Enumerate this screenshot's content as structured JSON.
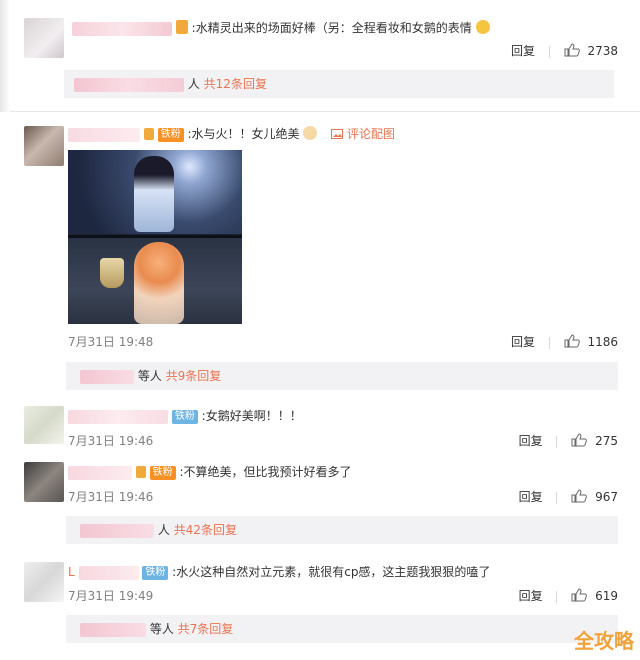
{
  "top_comment": {
    "text": ":水精灵出来的场面好棒（另：全程看妆和女鹅的表情",
    "actions": {
      "reply": "回复",
      "likes": "2738"
    },
    "replies": {
      "suffix": "人",
      "more": "共12条回复"
    }
  },
  "comment1": {
    "badge": "铁粉",
    "text": ":水与火！！女儿绝美",
    "pic_comment": "评论配图",
    "time": "7月31日 19:48",
    "actions": {
      "reply": "回复",
      "likes": "1186"
    },
    "replies": {
      "suffix": "等人",
      "more": "共9条回复"
    }
  },
  "comment2": {
    "badge": "铁粉",
    "text": ":女鹅好美啊！！！",
    "time": "7月31日 19:46",
    "actions": {
      "reply": "回复",
      "likes": "275"
    }
  },
  "comment3": {
    "badge": "铁粉",
    "text": ":不算绝美，但比我预计好看多了",
    "time": "7月31日 19:46",
    "actions": {
      "reply": "回复",
      "likes": "967"
    },
    "replies": {
      "suffix": "人",
      "more": "共42条回复"
    }
  },
  "comment4": {
    "name_prefix": "L",
    "badge": "铁粉",
    "text": ":水火这种自然对立元素，就很有cp感，这主题我狠狠的嗑了",
    "time": "7月31日 19:49",
    "actions": {
      "reply": "回复",
      "likes": "619"
    },
    "replies": {
      "suffix": "等人",
      "more": "共7条回复"
    }
  },
  "watermark": "全攻略",
  "colors": {
    "accent": "#eb7350",
    "replybar": "#f2f2f5",
    "badge_orange": "#f79124",
    "badge_blue": "#6db4e3"
  }
}
